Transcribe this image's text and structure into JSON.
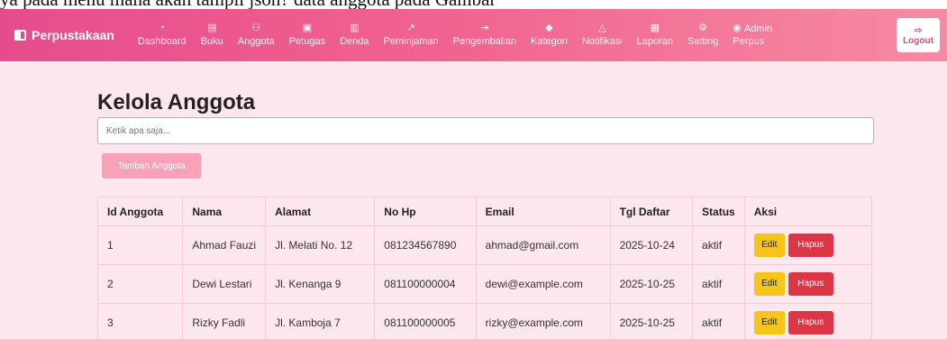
{
  "top_strip": {
    "text": "ya pada menu mana akan tampil json? data anggota pada Gambar"
  },
  "navbar": {
    "brand": "Perpustakaan",
    "items": [
      {
        "icon": "gauge-icon",
        "glyph": "◔",
        "label": "Dashboard"
      },
      {
        "icon": "book-icon",
        "glyph": "▤",
        "label": "Buku"
      },
      {
        "icon": "people-icon",
        "glyph": "⚇",
        "label": "Anggota"
      },
      {
        "icon": "badge-icon",
        "glyph": "▣",
        "label": "Petugas"
      },
      {
        "icon": "cash-icon",
        "glyph": "▥",
        "label": "Denda"
      },
      {
        "icon": "external-link-icon",
        "glyph": "↗",
        "label": "Peminjaman"
      },
      {
        "icon": "return-icon",
        "glyph": "⇥",
        "label": "Pengembalian"
      },
      {
        "icon": "tag-icon",
        "glyph": "◆",
        "label": "Kategori"
      },
      {
        "icon": "bell-icon",
        "glyph": "△",
        "label": "Notifikasi"
      },
      {
        "icon": "report-icon",
        "glyph": "▦",
        "label": "Laporan"
      },
      {
        "icon": "gear-icon",
        "glyph": "⚙",
        "label": "Setting"
      }
    ],
    "admin": {
      "label_line1": "Admin",
      "label_line2": "Perpus",
      "icon": "user-circle-icon"
    },
    "logout_label": "Logout"
  },
  "main": {
    "title": "Kelola Anggota",
    "search_placeholder": "Ketik apa saja...",
    "add_button": "Tambah Anggota",
    "table": {
      "headers": [
        "Id Anggota",
        "Nama",
        "Alamat",
        "No Hp",
        "Email",
        "Tgl Daftar",
        "Status",
        "Aksi"
      ],
      "rows": [
        {
          "id": "1",
          "nama": "Ahmad Fauzi",
          "alamat": "Jl. Melati No. 12",
          "nohp": "081234567890",
          "email": "ahmad@gmail.com",
          "tgl": "2025-10-24",
          "status": "aktif"
        },
        {
          "id": "2",
          "nama": "Dewi Lestari",
          "alamat": "Jl. Kenanga 9",
          "nohp": "081100000004",
          "email": "dewi@example.com",
          "tgl": "2025-10-25",
          "status": "aktif"
        },
        {
          "id": "3",
          "nama": "Rizky Fadli",
          "alamat": "Jl. Kamboja 7",
          "nohp": "081100000005",
          "email": "rizky@example.com",
          "tgl": "2025-10-25",
          "status": "aktif"
        }
      ],
      "edit_label": "Edit",
      "delete_label": "Hapus"
    }
  },
  "colors": {
    "navbar_start": "#e64c8d",
    "navbar_end": "#f78aa3",
    "content_bg": "#fde7ee",
    "edit_button": "#f5c518",
    "delete_button": "#dc3545",
    "add_button": "#f8a1b9"
  }
}
